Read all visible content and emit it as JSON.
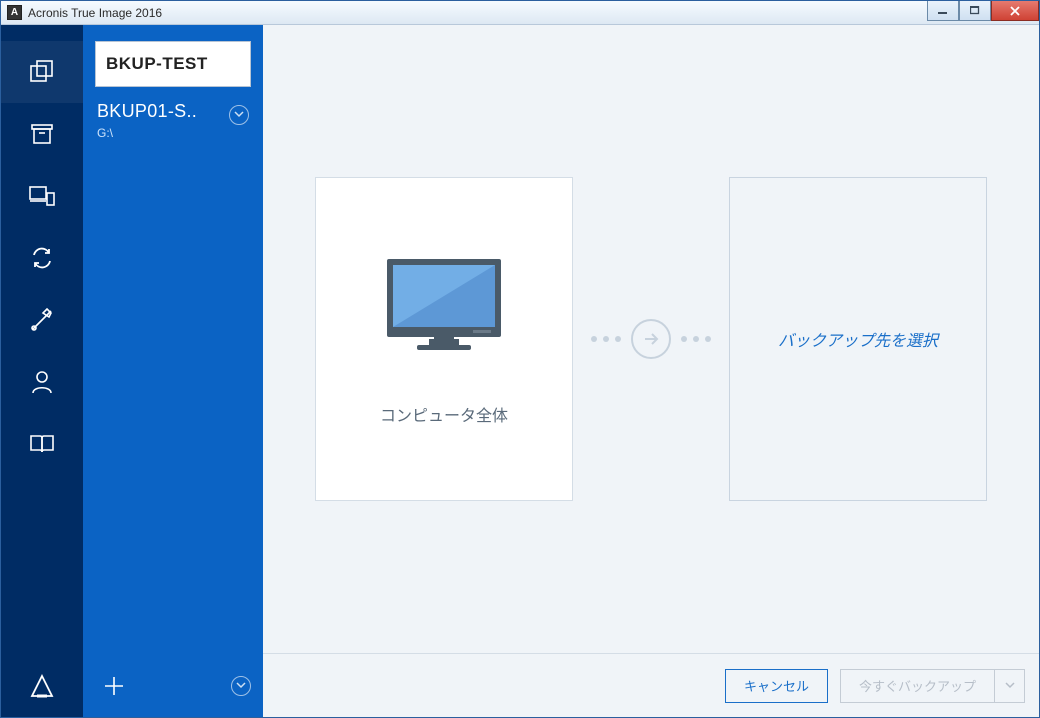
{
  "window": {
    "title": "Acronis True Image 2016",
    "app_icon_letter": "A"
  },
  "sidebar": {
    "tasks": [
      {
        "name": "BKUP-TEST"
      },
      {
        "name": "BKUP01-S..",
        "sub": "G:\\"
      }
    ]
  },
  "main": {
    "source_card_label": "コンピュータ全体",
    "destination_card_label": "バックアップ先を選択"
  },
  "buttons": {
    "cancel": "キャンセル",
    "primary": "今すぐバックアップ"
  }
}
